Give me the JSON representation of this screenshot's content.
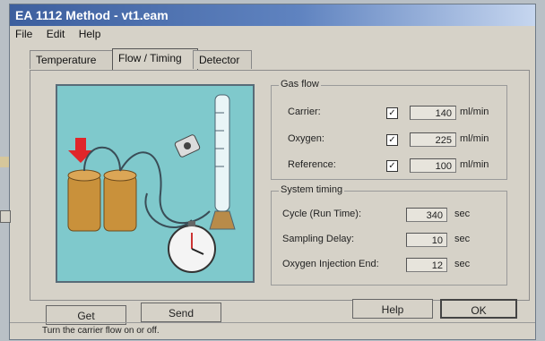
{
  "window": {
    "title": "EA 1112 Method - vt1.eam"
  },
  "menu": [
    "File",
    "Edit",
    "Help"
  ],
  "tabs": [
    {
      "label": "Temperature",
      "active": false
    },
    {
      "label": "Flow / Timing",
      "active": true
    },
    {
      "label": "Detector",
      "active": false
    }
  ],
  "gas_flow": {
    "title": "Gas flow",
    "rows": [
      {
        "label": "Carrier:",
        "checked": true,
        "value": "140",
        "unit": "ml/min"
      },
      {
        "label": "Oxygen:",
        "checked": true,
        "value": "225",
        "unit": "ml/min"
      },
      {
        "label": "Reference:",
        "checked": true,
        "value": "100",
        "unit": "ml/min"
      }
    ]
  },
  "system_timing": {
    "title": "System timing",
    "rows": [
      {
        "label": "Cycle (Run Time):",
        "value": "340",
        "unit": "sec"
      },
      {
        "label": "Sampling Delay:",
        "value": "10",
        "unit": "sec"
      },
      {
        "label": "Oxygen Injection End:",
        "value": "12",
        "unit": "sec"
      }
    ]
  },
  "buttons": {
    "get": "Get",
    "send": "Send",
    "help": "Help",
    "ok": "OK"
  },
  "status": "Turn the carrier flow on or off."
}
